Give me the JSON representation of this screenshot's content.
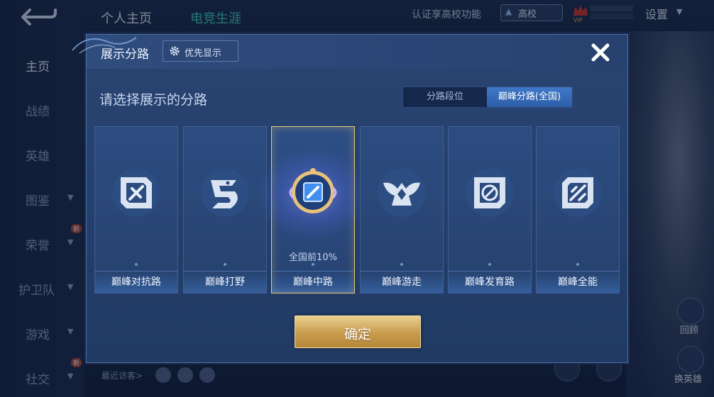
{
  "sidebar": {
    "items": [
      {
        "label": "主页",
        "active": true,
        "chevron": false,
        "new": false
      },
      {
        "label": "战绩",
        "active": false,
        "chevron": false,
        "new": false
      },
      {
        "label": "英雄",
        "active": false,
        "chevron": false,
        "new": false
      },
      {
        "label": "图鉴",
        "active": false,
        "chevron": true,
        "new": false
      },
      {
        "label": "荣誉",
        "active": false,
        "chevron": true,
        "new": true
      },
      {
        "label": "护卫队",
        "active": false,
        "chevron": true,
        "new": false
      },
      {
        "label": "游戏",
        "active": false,
        "chevron": true,
        "new": false
      },
      {
        "label": "社交",
        "active": false,
        "chevron": true,
        "new": true
      }
    ],
    "new_tag": "新"
  },
  "topbar": {
    "tab_profile": "个人主页",
    "tab_esports": "电竞生涯",
    "school_verify": "认证享高校功能",
    "school_badge": "高校",
    "vip_label": "VIP",
    "settings": "设置"
  },
  "right_panel": {
    "back_label": "回顾",
    "switch_hero_label": "换英雄"
  },
  "bottom": {
    "recent_visitors": "最近访客>"
  },
  "modal": {
    "title": "展示分路",
    "priority_button": "优先显示",
    "subtitle": "请选择展示的分路",
    "segment": {
      "option_1": "分路段位",
      "option_2": "巅峰分路(全国)",
      "selected": "巅峰分路(全国)"
    },
    "cards": [
      {
        "label": "巅峰对抗路",
        "icon": "sword-emblem-icon"
      },
      {
        "label": "巅峰打野",
        "icon": "dragon-emblem-icon"
      },
      {
        "label": "巅峰中路",
        "icon": "mid-lane-badge-icon",
        "rank": "全国前10%",
        "selected": true
      },
      {
        "label": "巅峰游走",
        "icon": "wings-emblem-icon"
      },
      {
        "label": "巅峰发育路",
        "icon": "target-emblem-icon"
      },
      {
        "label": "巅峰全能",
        "icon": "allround-emblem-icon"
      }
    ],
    "confirm_button": "确定"
  },
  "colors": {
    "accent_gold": "#d4ad62",
    "segment_active": "#3a6fbd",
    "panel_bg": "#24406c"
  }
}
